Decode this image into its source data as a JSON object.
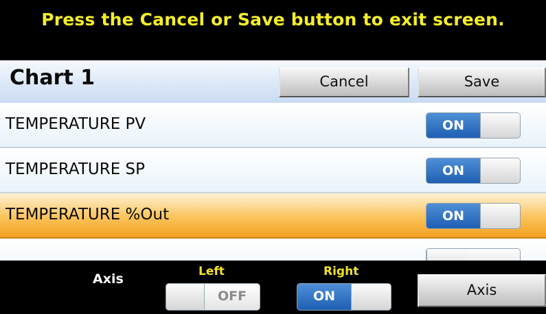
{
  "banner": {
    "text": "Press the Cancel or Save button to exit screen."
  },
  "header": {
    "title": "Chart 1",
    "cancel_label": "Cancel",
    "save_label": "Save"
  },
  "channels": [
    {
      "label": "TEMPERATURE PV",
      "state": "ON",
      "selected": false
    },
    {
      "label": "TEMPERATURE SP",
      "state": "ON",
      "selected": false
    },
    {
      "label": "TEMPERATURE %Out",
      "state": "ON",
      "selected": true
    }
  ],
  "footer": {
    "axis_label": "Axis",
    "left_label": "Left",
    "left_state": "OFF",
    "right_label": "Right",
    "right_state": "ON",
    "axis_button_label": "Axis"
  },
  "colors": {
    "banner_text": "#f4ee2a",
    "toggle_on": "#1e5fb4",
    "selected_row": "#f3a021",
    "sub_label": "#f2e22a"
  }
}
